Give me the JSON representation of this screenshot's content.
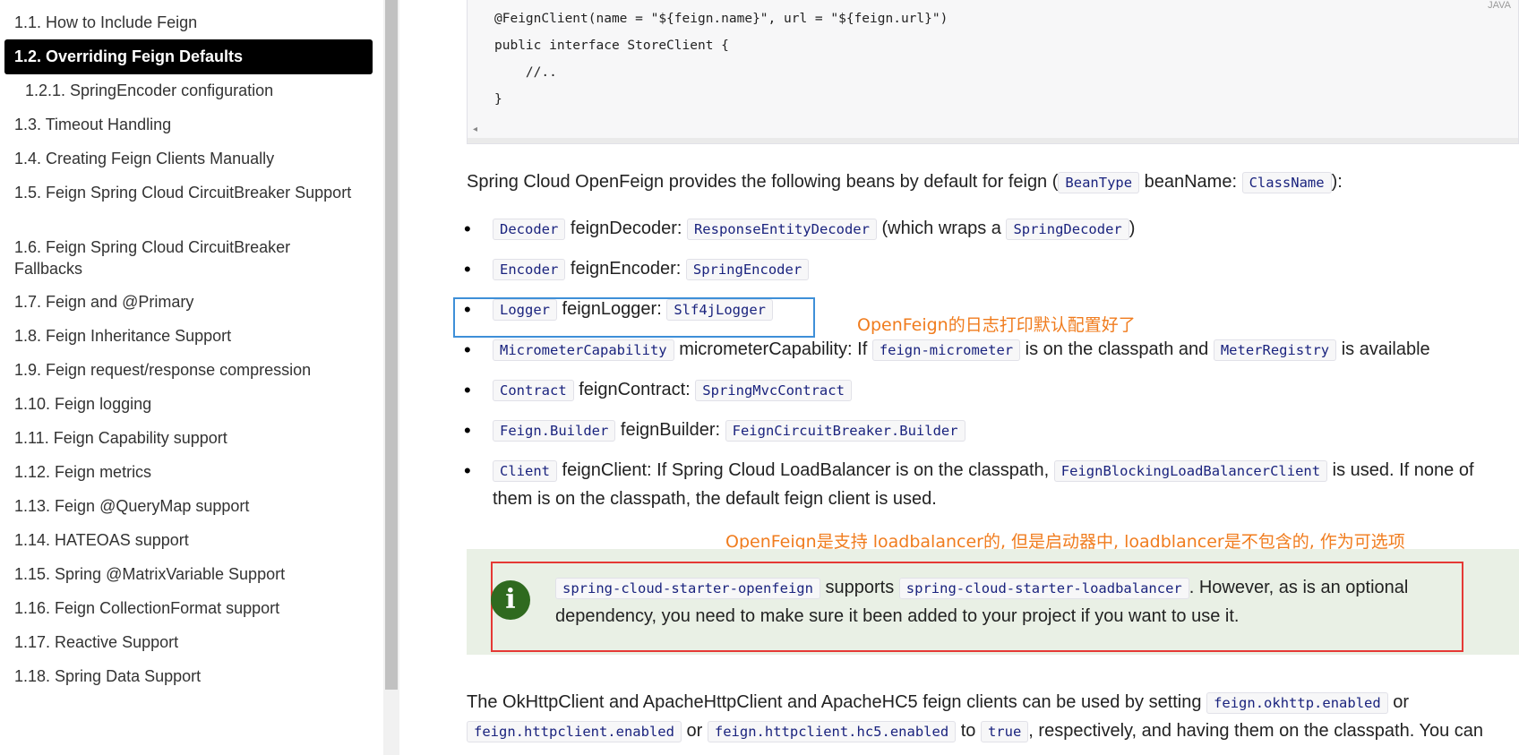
{
  "toc": {
    "items": [
      {
        "label": "1.1. How to Include Feign"
      },
      {
        "label": "1.2. Overriding Feign Defaults"
      },
      {
        "label": "1.2.1. SpringEncoder configuration"
      },
      {
        "label": "1.3. Timeout Handling"
      },
      {
        "label": "1.4. Creating Feign Clients Manually"
      },
      {
        "label": "1.5. Feign Spring Cloud CircuitBreaker Support"
      },
      {
        "label": "1.6. Feign Spring Cloud CircuitBreaker Fallbacks"
      },
      {
        "label": "1.7. Feign and @Primary"
      },
      {
        "label": "1.8. Feign Inheritance Support"
      },
      {
        "label": "1.9. Feign request/response compression"
      },
      {
        "label": "1.10. Feign logging"
      },
      {
        "label": "1.11. Feign Capability support"
      },
      {
        "label": "1.12. Feign metrics"
      },
      {
        "label": "1.13. Feign @QueryMap support"
      },
      {
        "label": "1.14. HATEOAS support"
      },
      {
        "label": "1.15. Spring @MatrixVariable Support"
      },
      {
        "label": "1.16. Feign CollectionFormat support"
      },
      {
        "label": "1.17. Reactive Support"
      },
      {
        "label": "1.18. Spring Data Support"
      }
    ],
    "active_index": 1
  },
  "code": {
    "lang": "JAVA",
    "text": "@FeignClient(name = \"${feign.name}\", url = \"${feign.url}\")\npublic interface StoreClient {\n    //..\n}"
  },
  "intro": {
    "before": "Spring Cloud OpenFeign provides the following beans by default for feign (",
    "code1": "BeanType",
    "mid": " beanName: ",
    "code2": "ClassName",
    "after": "):"
  },
  "beans": [
    {
      "type": "Decoder",
      "name": " feignDecoder: ",
      "cls": "ResponseEntityDecoder",
      "rest1": " (which wraps a ",
      "code3": "SpringDecoder",
      "rest2": ")"
    },
    {
      "type": "Encoder",
      "name": " feignEncoder: ",
      "cls": "SpringEncoder"
    },
    {
      "type": "Logger",
      "name": " feignLogger: ",
      "cls": "Slf4jLogger"
    },
    {
      "type": "MicrometerCapability",
      "name": " micrometerCapability: If ",
      "cls": "feign-micrometer",
      "rest1": " is on the classpath and ",
      "code3": "MeterRegistry",
      "rest2": " is available"
    },
    {
      "type": "Contract",
      "name": " feignContract: ",
      "cls": "SpringMvcContract"
    },
    {
      "type": "Feign.Builder",
      "name": " feignBuilder: ",
      "cls": "FeignCircuitBreaker.Builder"
    },
    {
      "type": "Client",
      "name": " feignClient: If Spring Cloud LoadBalancer is on the classpath, ",
      "cls": "FeignBlockingLoadBalancerClient",
      "rest1": " is used. If none of them is on the classpath, the default feign client is used."
    }
  ],
  "annotations": {
    "logger_note": "OpenFeign的日志打印默认配置好了",
    "lb_note": "OpenFeign是支持 loadbalancer的, 但是启动器中, loadblancer是不包含的, 作为可选项"
  },
  "admonition": {
    "code1": "spring-cloud-starter-openfeign",
    "mid": " supports ",
    "code2": "spring-cloud-starter-loadbalancer",
    "after": ". However, as is an optional dependency, you need to make sure it been added to your project if you want to use it."
  },
  "outro": {
    "t1": "The OkHttpClient and ApacheHttpClient and ApacheHC5 feign clients can be used by setting ",
    "c1": "feign.okhttp.enabled",
    "t2": " or ",
    "c2": "feign.httpclient.enabled",
    "t3": " or ",
    "c3": "feign.httpclient.hc5.enabled",
    "t4": " to ",
    "c4": "true",
    "t5": ", respectively, and having them on the classpath. You can"
  },
  "colors": {
    "annotation": "#f07c1e",
    "highlight_blue": "#3e8fd8",
    "highlight_red": "#e53935",
    "admonition_bg": "#e9f0e5",
    "info_icon": "#2f6a1f"
  }
}
